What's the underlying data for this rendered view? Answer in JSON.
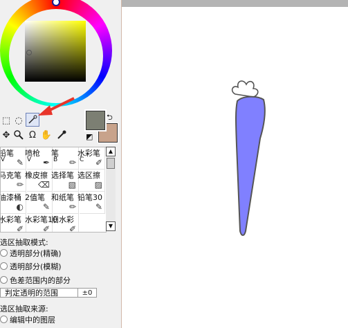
{
  "colors": {
    "panel_bg": "#f0f0f0",
    "main_color": "#7c7f73",
    "secondary_color": "#c8a38b",
    "carrot_body": "#8080ff",
    "carrot_outline": "#555555",
    "annotation_arrow": "#e8352a"
  },
  "tools": [
    {
      "name": "rect-select-icon"
    },
    {
      "name": "lasso-select-icon"
    },
    {
      "name": "magic-wand-icon",
      "selected": true
    },
    {
      "name": "move-icon"
    },
    {
      "name": "zoom-icon"
    },
    {
      "name": "rotate-icon"
    },
    {
      "name": "hand-icon"
    },
    {
      "name": "eyedropper-icon"
    }
  ],
  "brushes": [
    {
      "name": "铅笔",
      "key": "V"
    },
    {
      "name": "喷枪",
      "key": "V"
    },
    {
      "name": "笔",
      "key": "B"
    },
    {
      "name": "水彩笔",
      "key": "C"
    },
    {
      "name": "马克笔",
      "key": ""
    },
    {
      "name": "橡皮擦",
      "key": ""
    },
    {
      "name": "选择笔",
      "key": ""
    },
    {
      "name": "选区擦",
      "key": ""
    },
    {
      "name": "油漆桶",
      "key": ""
    },
    {
      "name": "2值笔",
      "key": ""
    },
    {
      "name": "和纸笔",
      "key": ""
    },
    {
      "name": "铅笔30",
      "key": ""
    },
    {
      "name": "水彩笔",
      "key": ""
    },
    {
      "name": "水彩笔10",
      "key": ""
    },
    {
      "name": "旧水彩",
      "key": ""
    }
  ],
  "selection": {
    "mode_heading": "选区抽取模式:",
    "mode_options": [
      "透明部分(精确)",
      "透明部分(模糊)",
      "色差范围内的部分"
    ],
    "range_label": "判定透明的范围",
    "range_value": "±0",
    "source_heading": "选区抽取来源:",
    "source_option": "编辑中的图层"
  }
}
